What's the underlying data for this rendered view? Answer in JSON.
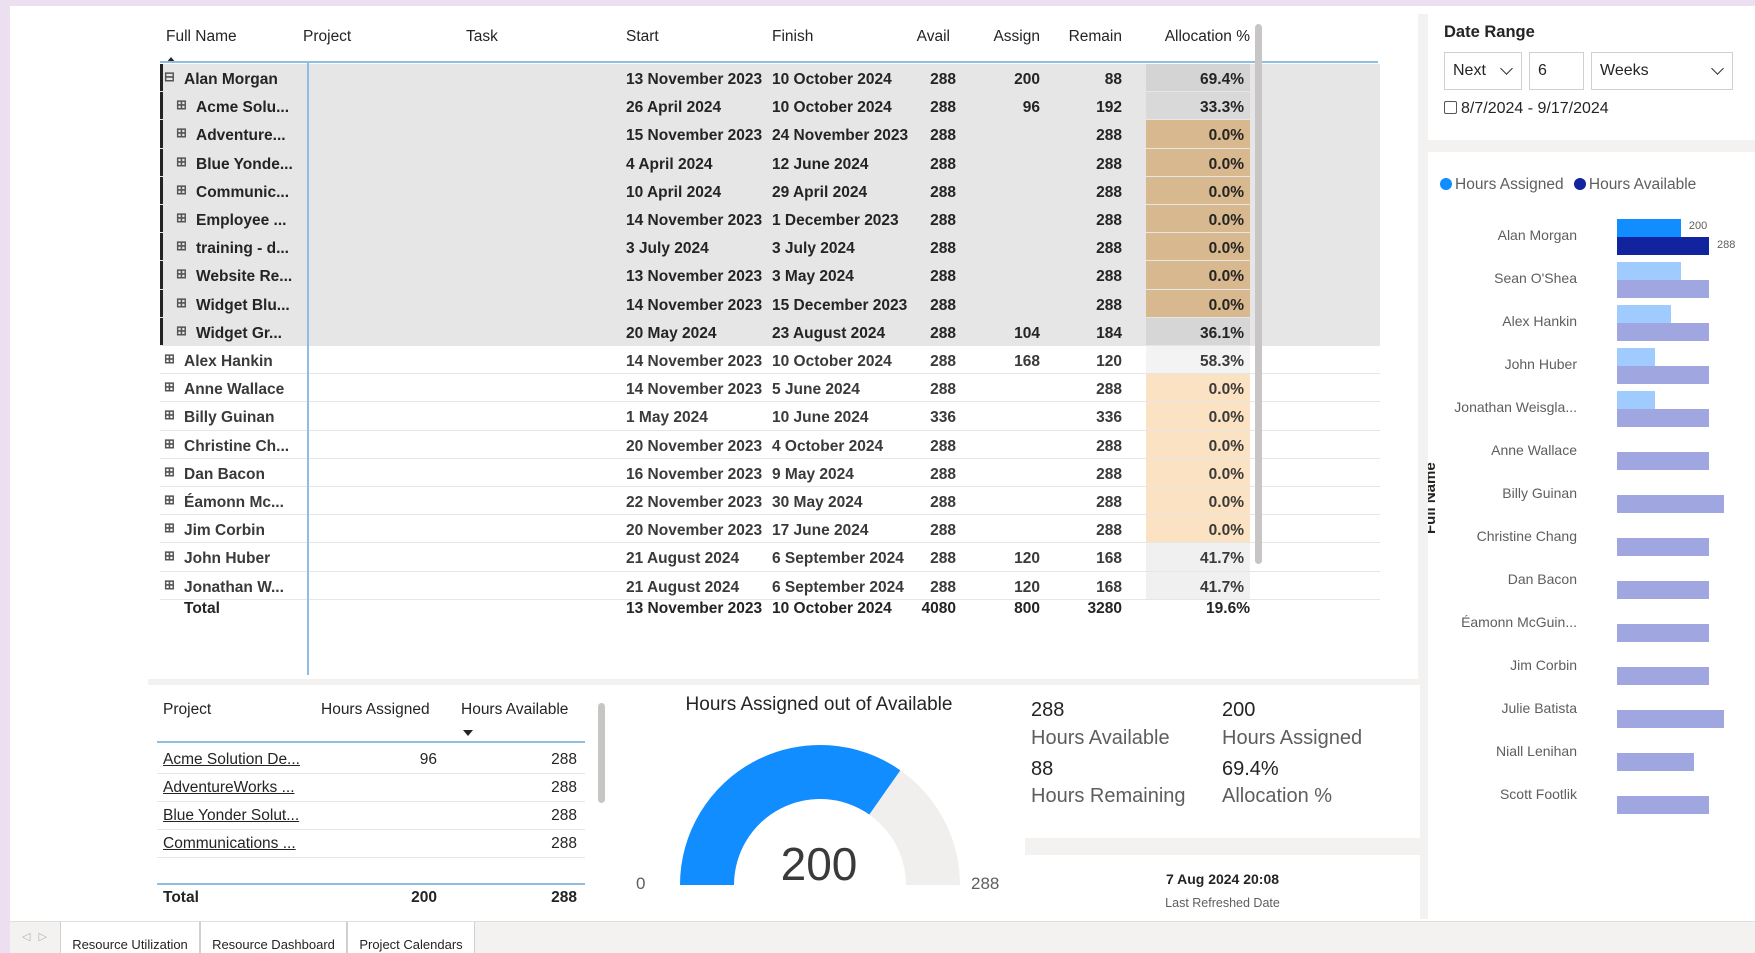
{
  "matrix": {
    "headers": {
      "full_name": "Full Name",
      "project": "Project",
      "task": "Task",
      "start": "Start",
      "finish": "Finish",
      "avail": "Avail",
      "assign": "Assign",
      "remain": "Remain",
      "alloc": "Allocation %"
    },
    "rows": [
      {
        "name": "Alan Morgan",
        "start": "13 November 2023",
        "finish": "10 October 2024",
        "avail": "288",
        "assign": "200",
        "remain": "88",
        "alloc": "69.4%",
        "expand": "⊟",
        "level": 0,
        "selected": true,
        "alloc_color": "#d4d4d4"
      },
      {
        "name": "Acme Solu...",
        "start": "26 April 2024",
        "finish": "10 October 2024",
        "avail": "288",
        "assign": "96",
        "remain": "192",
        "alloc": "33.3%",
        "expand": "⊞",
        "level": 1,
        "selected": true,
        "alloc_color": "#d9d9d9"
      },
      {
        "name": "Adventure...",
        "start": "15 November 2023",
        "finish": "24 November 2023",
        "avail": "288",
        "assign": "",
        "remain": "288",
        "alloc": "0.0%",
        "expand": "⊞",
        "level": 1,
        "selected": true,
        "alloc_color": "#d8b88e"
      },
      {
        "name": "Blue Yonde...",
        "start": "4 April 2024",
        "finish": "12 June 2024",
        "avail": "288",
        "assign": "",
        "remain": "288",
        "alloc": "0.0%",
        "expand": "⊞",
        "level": 1,
        "selected": true,
        "alloc_color": "#d8b88e"
      },
      {
        "name": "Communic...",
        "start": "10 April 2024",
        "finish": "29 April 2024",
        "avail": "288",
        "assign": "",
        "remain": "288",
        "alloc": "0.0%",
        "expand": "⊞",
        "level": 1,
        "selected": true,
        "alloc_color": "#d8b88e"
      },
      {
        "name": "Employee ...",
        "start": "14 November 2023",
        "finish": "1 December 2023",
        "avail": "288",
        "assign": "",
        "remain": "288",
        "alloc": "0.0%",
        "expand": "⊞",
        "level": 1,
        "selected": true,
        "alloc_color": "#d8b88e"
      },
      {
        "name": "training - d...",
        "start": "3 July 2024",
        "finish": "3 July 2024",
        "avail": "288",
        "assign": "",
        "remain": "288",
        "alloc": "0.0%",
        "expand": "⊞",
        "level": 1,
        "selected": true,
        "alloc_color": "#d8b88e"
      },
      {
        "name": "Website Re...",
        "start": "13 November 2023",
        "finish": "3 May 2024",
        "avail": "288",
        "assign": "",
        "remain": "288",
        "alloc": "0.0%",
        "expand": "⊞",
        "level": 1,
        "selected": true,
        "alloc_color": "#d8b88e"
      },
      {
        "name": "Widget Blu...",
        "start": "14 November 2023",
        "finish": "15 December 2023",
        "avail": "288",
        "assign": "",
        "remain": "288",
        "alloc": "0.0%",
        "expand": "⊞",
        "level": 1,
        "selected": true,
        "alloc_color": "#d8b88e"
      },
      {
        "name": "Widget Gr...",
        "start": "20 May 2024",
        "finish": "23 August 2024",
        "avail": "288",
        "assign": "104",
        "remain": "184",
        "alloc": "36.1%",
        "expand": "⊞",
        "level": 1,
        "selected": true,
        "alloc_color": "#d6d6d6"
      },
      {
        "name": "Alex Hankin",
        "start": "14 November 2023",
        "finish": "10 October 2024",
        "avail": "288",
        "assign": "168",
        "remain": "120",
        "alloc": "58.3%",
        "expand": "⊞",
        "level": 0,
        "selected": false,
        "alloc_color": "#f3f3f3"
      },
      {
        "name": "Anne Wallace",
        "start": "14 November 2023",
        "finish": "5 June 2024",
        "avail": "288",
        "assign": "",
        "remain": "288",
        "alloc": "0.0%",
        "expand": "⊞",
        "level": 0,
        "selected": false,
        "alloc_color": "#fbe2c2"
      },
      {
        "name": "Billy Guinan",
        "start": "1 May 2024",
        "finish": "10 June 2024",
        "avail": "336",
        "assign": "",
        "remain": "336",
        "alloc": "0.0%",
        "expand": "⊞",
        "level": 0,
        "selected": false,
        "alloc_color": "#fbe2c2"
      },
      {
        "name": "Christine Ch...",
        "start": "20 November 2023",
        "finish": "4 October 2024",
        "avail": "288",
        "assign": "",
        "remain": "288",
        "alloc": "0.0%",
        "expand": "⊞",
        "level": 0,
        "selected": false,
        "alloc_color": "#fbe2c2"
      },
      {
        "name": "Dan Bacon",
        "start": "16 November 2023",
        "finish": "9 May 2024",
        "avail": "288",
        "assign": "",
        "remain": "288",
        "alloc": "0.0%",
        "expand": "⊞",
        "level": 0,
        "selected": false,
        "alloc_color": "#fbe2c2"
      },
      {
        "name": "Éamonn Mc...",
        "start": "22 November 2023",
        "finish": "30 May 2024",
        "avail": "288",
        "assign": "",
        "remain": "288",
        "alloc": "0.0%",
        "expand": "⊞",
        "level": 0,
        "selected": false,
        "alloc_color": "#fbe2c2"
      },
      {
        "name": "Jim Corbin",
        "start": "20 November 2023",
        "finish": "17 June 2024",
        "avail": "288",
        "assign": "",
        "remain": "288",
        "alloc": "0.0%",
        "expand": "⊞",
        "level": 0,
        "selected": false,
        "alloc_color": "#fbe2c2"
      },
      {
        "name": "John Huber",
        "start": "21 August 2024",
        "finish": "6 September 2024",
        "avail": "288",
        "assign": "120",
        "remain": "168",
        "alloc": "41.7%",
        "expand": "⊞",
        "level": 0,
        "selected": false,
        "alloc_color": "#f0f0f0"
      },
      {
        "name": "Jonathan W...",
        "start": "21 August 2024",
        "finish": "6 September 2024",
        "avail": "288",
        "assign": "120",
        "remain": "168",
        "alloc": "41.7%",
        "expand": "⊞",
        "level": 0,
        "selected": false,
        "alloc_color": "#f0f0f0"
      }
    ],
    "total": {
      "label": "Total",
      "start": "13 November 2023",
      "finish": "10 October 2024",
      "avail": "4080",
      "assign": "800",
      "remain": "3280",
      "alloc": "19.6%"
    }
  },
  "date_range": {
    "title": "Date Range",
    "relative": "Next",
    "count": "6",
    "unit": "Weeks",
    "range_text": "8/7/2024 - 9/17/2024"
  },
  "bar_chart": {
    "legend": [
      {
        "label": "Hours Assigned",
        "color": "#118dff"
      },
      {
        "label": "Hours Available",
        "color": "#12239e"
      }
    ],
    "axis_title": "Full Name",
    "colors": {
      "assigned": "#118dff",
      "available": "#12239e",
      "assigned_dim": "#a0cbff",
      "available_dim": "#a0a7e0"
    }
  },
  "chart_data": {
    "type": "bar",
    "categories": [
      "Alan Morgan",
      "Sean O'Shea",
      "Alex Hankin",
      "John Huber",
      "Jonathan Weisgla...",
      "Anne Wallace",
      "Billy Guinan",
      "Christine Chang",
      "Dan Bacon",
      "Éamonn McGuin...",
      "Jim Corbin",
      "Julie Batista",
      "Niall Lenihan",
      "Scott Footlik"
    ],
    "series": [
      {
        "name": "Hours Assigned",
        "values": [
          200,
          200,
          168,
          120,
          120,
          0,
          0,
          0,
          0,
          0,
          0,
          0,
          0,
          0
        ]
      },
      {
        "name": "Hours Available",
        "values": [
          288,
          288,
          288,
          288,
          288,
          288,
          336,
          288,
          288,
          288,
          288,
          336,
          240,
          288
        ]
      }
    ],
    "data_labels": {
      "assigned": "200",
      "available": "288"
    },
    "xlabel": "",
    "ylabel": "Full Name",
    "xlim": [
      0,
      350
    ],
    "orientation": "horizontal",
    "legend_position": "top-left",
    "grid": false
  },
  "project_table": {
    "headers": {
      "project": "Project",
      "assigned": "Hours Assigned",
      "available": "Hours Available"
    },
    "rows": [
      {
        "project": "Acme Solution De...",
        "assigned": "96",
        "available": "288"
      },
      {
        "project": "AdventureWorks ...",
        "assigned": "",
        "available": "288"
      },
      {
        "project": "Blue Yonder Solut...",
        "assigned": "",
        "available": "288"
      },
      {
        "project": "Communications ...",
        "assigned": "",
        "available": "288"
      }
    ],
    "total": {
      "label": "Total",
      "assigned": "200",
      "available": "288"
    }
  },
  "gauge": {
    "title": "Hours Assigned out of Available",
    "value": 200,
    "value_label": "200",
    "min_label": "0",
    "max": 288,
    "max_label": "288",
    "fill_color": "#118dff",
    "track_color": "#f0efee"
  },
  "kpi": {
    "hours_available_value": "288",
    "hours_available_label": "Hours Available",
    "hours_assigned_value": "200",
    "hours_assigned_label": "Hours Assigned",
    "hours_remaining_value": "88",
    "hours_remaining_label": "Hours Remaining",
    "allocation_value": "69.4%",
    "allocation_label": "Allocation %"
  },
  "refresh": {
    "date": "7 Aug 2024 20:08",
    "label": "Last Refreshed Date"
  },
  "tabs": [
    {
      "label": "Resource Utilization",
      "active": false
    },
    {
      "label": "Resource Dashboard",
      "active": true
    },
    {
      "label": "Project Calendars",
      "active": false
    }
  ]
}
